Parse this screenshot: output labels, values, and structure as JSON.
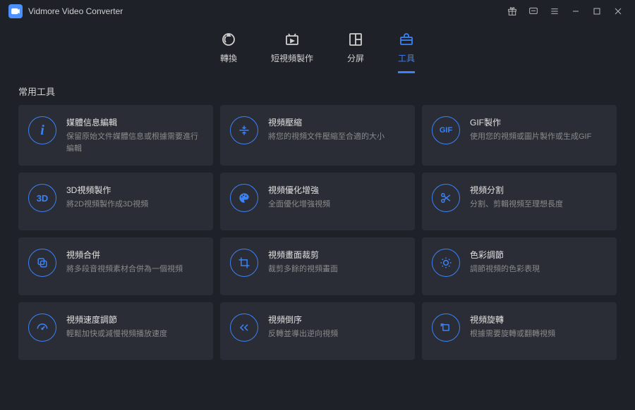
{
  "app": {
    "title": "Vidmore Video Converter"
  },
  "tabs": [
    {
      "label": "轉換"
    },
    {
      "label": "短視頻製作"
    },
    {
      "label": "分屏"
    },
    {
      "label": "工具"
    }
  ],
  "section": {
    "title": "常用工具"
  },
  "cards": [
    {
      "title": "媒體信息編輯",
      "desc": "保留原始文件媒體信息或根據需要進行編輯"
    },
    {
      "title": "視頻壓縮",
      "desc": "將您的視頻文件壓縮至合適的大小"
    },
    {
      "title": "GIF製作",
      "desc": "使用您的視頻或圖片製作或生成GIF"
    },
    {
      "title": "3D視頻製作",
      "desc": "將2D視頻製作成3D視頻"
    },
    {
      "title": "視頻優化增強",
      "desc": "全面優化增強視頻"
    },
    {
      "title": "視頻分割",
      "desc": "分割、剪輯視頻至理想長度"
    },
    {
      "title": "視頻合併",
      "desc": "將多段音視頻素材合併為一個視頻"
    },
    {
      "title": "視頻畫面裁剪",
      "desc": "裁剪多餘的視頻畫面"
    },
    {
      "title": "色彩調節",
      "desc": "調節視頻的色彩表現"
    },
    {
      "title": "視頻速度調節",
      "desc": "輕鬆加快或減慢視頻播放速度"
    },
    {
      "title": "視頻倒序",
      "desc": "反轉並導出逆向視頻"
    },
    {
      "title": "視頻旋轉",
      "desc": "根據需要旋轉或翻轉視頻"
    }
  ],
  "icons": {
    "gif": "GIF",
    "threeD": "3D"
  }
}
